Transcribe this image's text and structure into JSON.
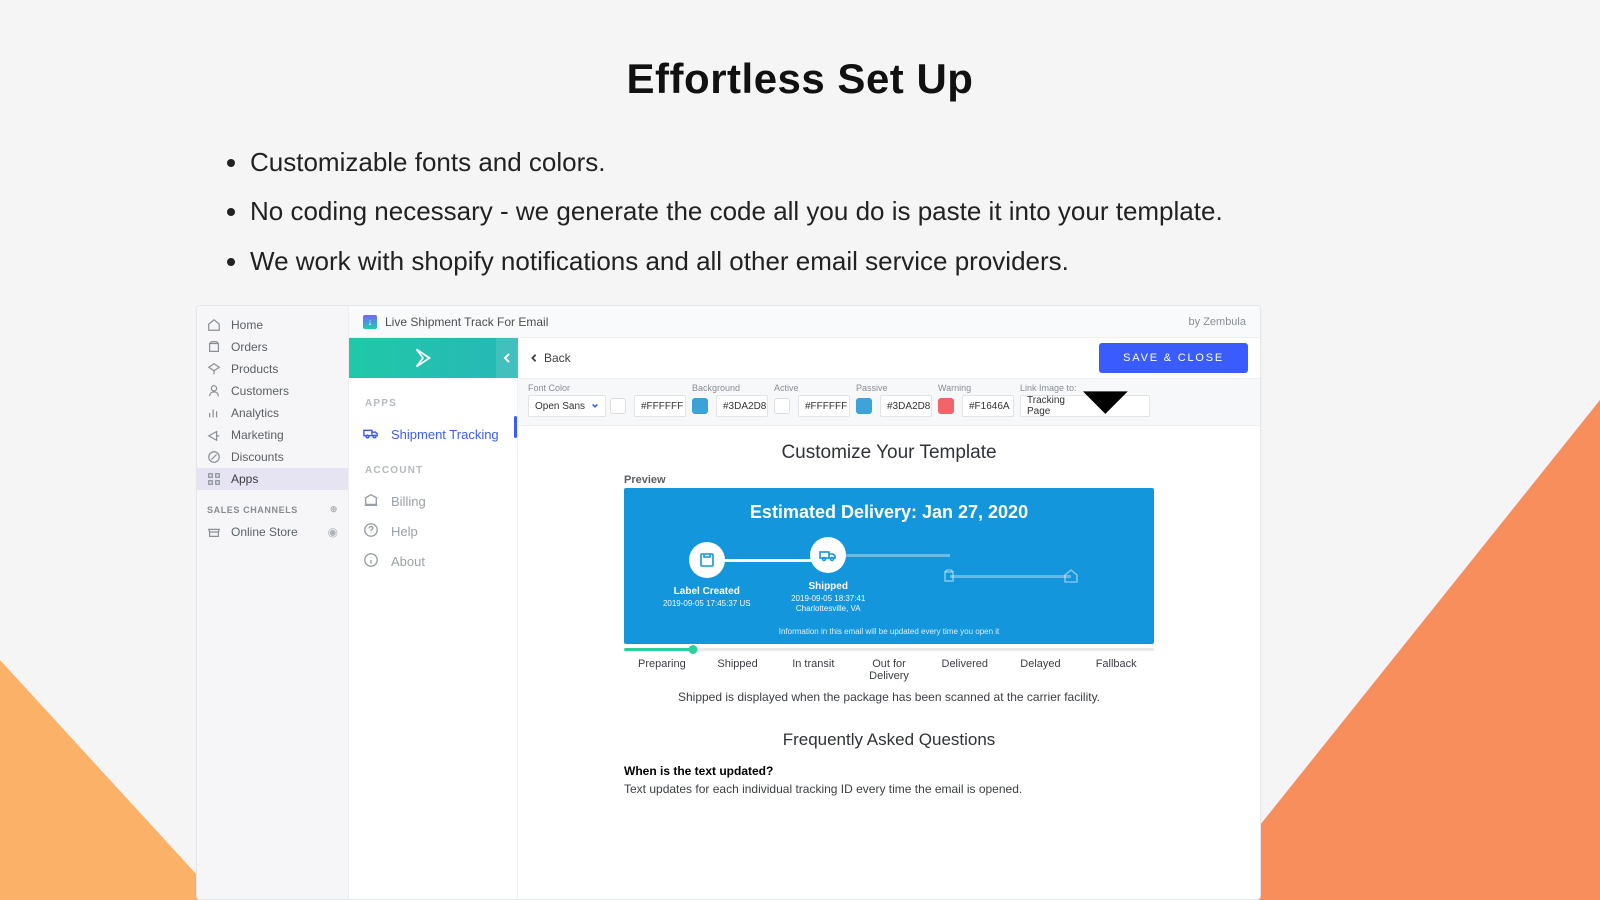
{
  "hero": {
    "title": "Effortless Set Up",
    "bullets": [
      "Customizable fonts and colors.",
      "No coding necessary - we generate the code all you do is paste it into your template.",
      "We work with shopify notifications and all other email service providers."
    ]
  },
  "shopNav": {
    "items": [
      {
        "label": "Home",
        "icon": "home"
      },
      {
        "label": "Orders",
        "icon": "orders"
      },
      {
        "label": "Products",
        "icon": "products"
      },
      {
        "label": "Customers",
        "icon": "customers"
      },
      {
        "label": "Analytics",
        "icon": "analytics"
      },
      {
        "label": "Marketing",
        "icon": "marketing"
      },
      {
        "label": "Discounts",
        "icon": "discounts"
      },
      {
        "label": "Apps",
        "icon": "apps",
        "active": true
      }
    ],
    "salesSection": "SALES CHANNELS",
    "salesItems": [
      {
        "label": "Online Store",
        "icon": "store"
      }
    ]
  },
  "titlebar": {
    "title": "Live Shipment Track For Email",
    "by": "by Zembula"
  },
  "actbar": {
    "back": "Back",
    "save": "SAVE & CLOSE"
  },
  "appNav": {
    "sec1": "APPS",
    "item1": "Shipment Tracking",
    "sec2": "ACCOUNT",
    "item2": "Billing",
    "item3": "Help",
    "item4": "About"
  },
  "cfg": {
    "fontColorLabel": "Font Color",
    "font": "Open Sans",
    "fontHex": "#FFFFFF",
    "bgLabel": "Background",
    "bgHex": "#3DA2D8",
    "activeLabel": "Active",
    "activeHex": "#FFFFFF",
    "passiveLabel": "Passive",
    "passiveHex": "#3DA2D8",
    "warnLabel": "Warning",
    "warnHex": "#F1646A",
    "linkLabel": "Link Image to:",
    "linkVal": "Tracking Page"
  },
  "content": {
    "heading": "Customize Your Template",
    "previewLabel": "Preview",
    "pvTitle": "Estimated Delivery: Jan 27, 2020",
    "nodes": [
      {
        "cap": "Label Created",
        "sub": "2019-09-05 17:45:37 US"
      },
      {
        "cap": "Shipped",
        "sub": "2019-09-05 18:37:41 Charlottesville, VA"
      }
    ],
    "pvNote": "Information in this email will be updated every time you open it",
    "states": [
      "Preparing",
      "Shipped",
      "In transit",
      "Out for Delivery",
      "Delivered",
      "Delayed",
      "Fallback"
    ],
    "stateDesc": "Shipped is displayed when the package has been scanned at the carrier facility.",
    "faqTitle": "Frequently Asked Questions",
    "faqQ": "When is the text updated?",
    "faqA": "Text updates for each individual tracking ID every time the email is opened."
  }
}
